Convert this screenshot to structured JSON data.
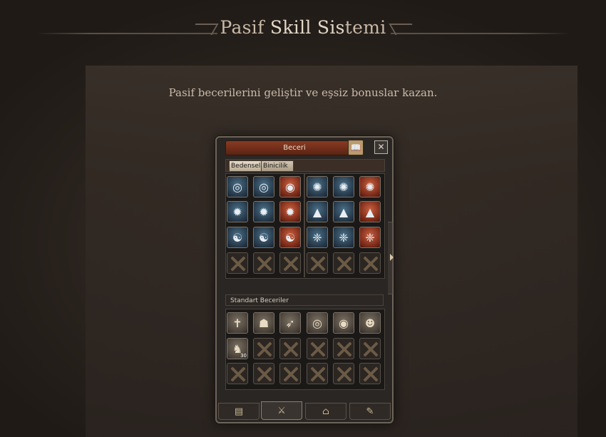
{
  "page": {
    "title_part1": "Pasif ",
    "title_part2": "Skill Sis",
    "title_part3": "temi",
    "subtitle": "Pasif becerilerini geliştir ve eşsiz bonuslar kazan."
  },
  "window": {
    "title": "Beceri",
    "close_label": "✕",
    "tabs": [
      {
        "label": "Bedensel"
      },
      {
        "label": "Binicilik"
      }
    ],
    "section_label": "Standart Beceriler",
    "skill_grid": {
      "rows": [
        [
          {
            "icon": "blue-spiral-icon",
            "glyph": "◎",
            "color": "blue"
          },
          {
            "icon": "blue-spiral-icon",
            "glyph": "◎",
            "color": "blue"
          },
          {
            "icon": "white-spiral-icon",
            "glyph": "◉",
            "color": "red"
          },
          {
            "icon": "blue-burst-icon",
            "glyph": "✺",
            "color": "blue"
          },
          {
            "icon": "blue-burst-icon",
            "glyph": "✺",
            "color": "blue"
          },
          {
            "icon": "red-burst-icon",
            "glyph": "✺",
            "color": "red"
          }
        ],
        [
          {
            "icon": "blue-star-icon",
            "glyph": "✹",
            "color": "blue"
          },
          {
            "icon": "blue-star-icon",
            "glyph": "✹",
            "color": "blue"
          },
          {
            "icon": "red-star-icon",
            "glyph": "✹",
            "color": "red"
          },
          {
            "icon": "blue-tree-icon",
            "glyph": "▲",
            "color": "blue"
          },
          {
            "icon": "blue-tree-icon",
            "glyph": "▲",
            "color": "blue"
          },
          {
            "icon": "red-tree-icon",
            "glyph": "▲",
            "color": "red"
          }
        ],
        [
          {
            "icon": "blue-yin-yang-icon",
            "glyph": "☯",
            "color": "blue"
          },
          {
            "icon": "blue-yin-yang-icon",
            "glyph": "☯",
            "color": "blue"
          },
          {
            "icon": "red-yin-yang-icon",
            "glyph": "☯",
            "color": "red"
          },
          {
            "icon": "blue-branch-icon",
            "glyph": "❈",
            "color": "blue"
          },
          {
            "icon": "blue-branch-icon",
            "glyph": "❈",
            "color": "blue"
          },
          {
            "icon": "red-branch-icon",
            "glyph": "❈",
            "color": "red"
          }
        ]
      ]
    },
    "standard_skills": [
      {
        "icon": "cross-sword-icon",
        "glyph": "✝"
      },
      {
        "icon": "hood-icon",
        "glyph": "☗"
      },
      {
        "icon": "feather-icon",
        "glyph": "➶"
      },
      {
        "icon": "target-icon",
        "glyph": "◎"
      },
      {
        "icon": "bullseye-arrow-icon",
        "glyph": "◉"
      },
      {
        "icon": "head-silhouette-icon",
        "glyph": "☻"
      },
      {
        "icon": "horse-head-icon",
        "glyph": "♞",
        "badge": "30"
      }
    ],
    "bottom_tabs": [
      {
        "icon": "character-card-icon",
        "glyph": "▤"
      },
      {
        "icon": "sword-icon",
        "glyph": "⚔"
      },
      {
        "icon": "bell-icon",
        "glyph": "⌂"
      },
      {
        "icon": "tools-icon",
        "glyph": "✎"
      }
    ]
  }
}
